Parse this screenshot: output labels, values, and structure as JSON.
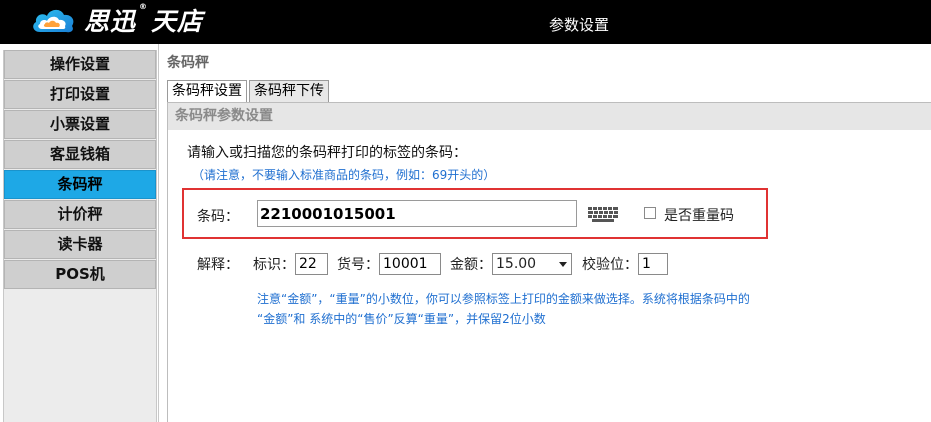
{
  "header": {
    "logo_text": "思迅",
    "logo_reg": "®",
    "logo_text2": "天店",
    "title": "参数设置"
  },
  "sidebar": {
    "items": [
      {
        "label": "操作设置",
        "active": false
      },
      {
        "label": "打印设置",
        "active": false
      },
      {
        "label": "小票设置",
        "active": false
      },
      {
        "label": "客显钱箱",
        "active": false
      },
      {
        "label": "条码秤",
        "active": true
      },
      {
        "label": "计价秤",
        "active": false
      },
      {
        "label": "读卡器",
        "active": false
      },
      {
        "label": "POS机",
        "active": false
      }
    ]
  },
  "main": {
    "section_title": "条码秤",
    "tabs": [
      {
        "label": "条码秤设置",
        "active": true
      },
      {
        "label": "条码秤下传",
        "active": false
      }
    ],
    "panel_header": "条码秤参数设置",
    "prompt": "请输入或扫描您的条码秤打印的标签的条码：",
    "note1": "（请注意，不要输入标准商品的条码，例如：69开头的）",
    "barcode": {
      "label": "条码：",
      "value": "2210001015001",
      "keyboard_icon": "keyboard-icon",
      "weight_code_label": "是否重量码",
      "weight_code_checked": false
    },
    "explanation": {
      "label": "解释：",
      "id_label": "标识：",
      "id_value": "22",
      "item_no_label": "货号：",
      "item_no_value": "10001",
      "amount_label": "金额：",
      "amount_value": "15.00",
      "check_label": "校验位：",
      "check_value": "1"
    },
    "note2_line1": "注意“金额”，“重量”的小数位，你可以参照标签上打印的金额来做选择。系统将根据条码中的",
    "note2_line2": "“金额”和 系统中的“售价”反算“重量”，并保留2位小数"
  },
  "colors": {
    "header_bg": "#000000",
    "active_item": "#1ea8e6",
    "highlight_border": "#e03232",
    "note_text": "#1f6fd0"
  }
}
